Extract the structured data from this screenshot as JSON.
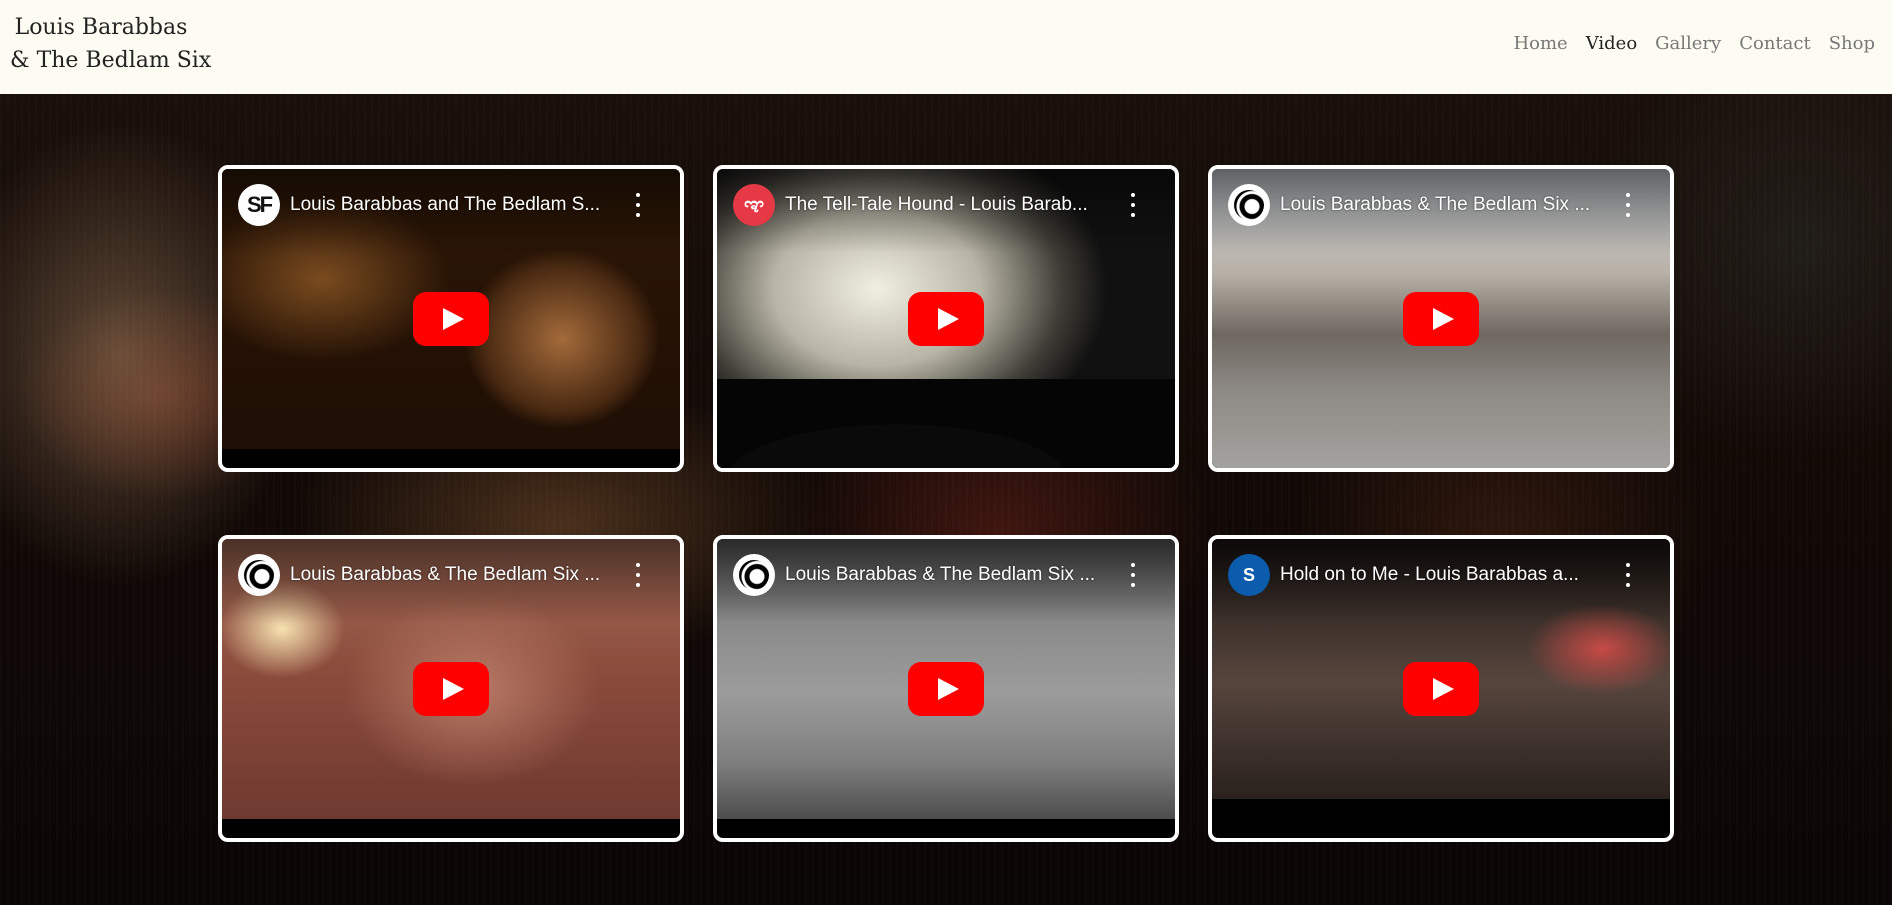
{
  "site": {
    "title_line1": "Louis Barabbas",
    "title_line2": "& The Bedlam Six"
  },
  "nav": {
    "items": [
      {
        "label": "Home",
        "active": false
      },
      {
        "label": "Video",
        "active": true
      },
      {
        "label": "Gallery",
        "active": false
      },
      {
        "label": "Contact",
        "active": false
      },
      {
        "label": "Shop",
        "active": false
      }
    ]
  },
  "videos": [
    {
      "title": "Louis Barabbas and The Bedlam S...",
      "channel_icon": "sf-logo-icon",
      "channel_initials": "SF"
    },
    {
      "title": "The Tell-Tale Hound - Louis Barab...",
      "channel_icon": "red-circle-logo-icon",
      "channel_initials": "ಞ"
    },
    {
      "title": "Louis Barabbas & The Bedlam Six ...",
      "channel_icon": "wave-logo-icon",
      "channel_initials": ""
    },
    {
      "title": "Louis Barabbas & The Bedlam Six ...",
      "channel_icon": "wave-logo-icon",
      "channel_initials": ""
    },
    {
      "title": "Louis Barabbas & The Bedlam Six ...",
      "channel_icon": "wave-logo-icon",
      "channel_initials": ""
    },
    {
      "title": "Hold on to Me - Louis Barabbas a...",
      "channel_icon": "s-logo-icon",
      "channel_initials": "S"
    }
  ],
  "colors": {
    "header_bg": "#fdfcf3",
    "play_button": "#ff0000",
    "nav_active": "#222222",
    "nav_inactive": "#777777"
  }
}
